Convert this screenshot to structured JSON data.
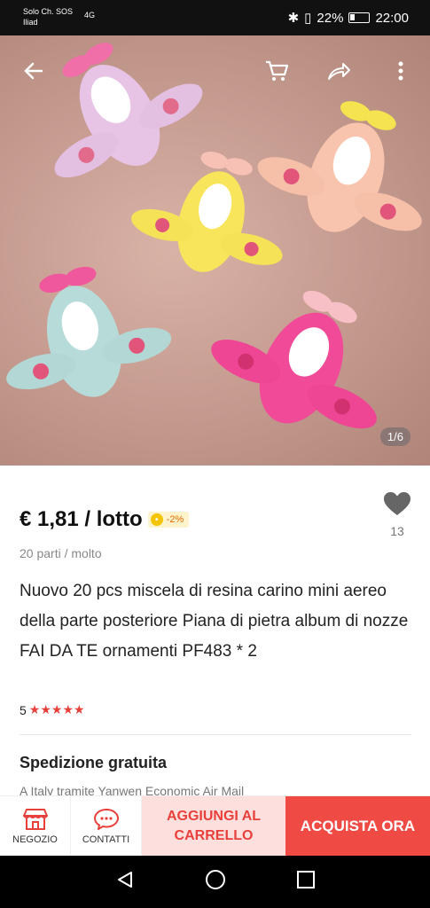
{
  "status_bar": {
    "carrier_line1": "Solo Ch. SOS",
    "carrier_line2": "Iliad",
    "signal_text": "4G",
    "battery_percent": "22%",
    "time": "22:00"
  },
  "hero": {
    "image_counter": "1/6"
  },
  "product": {
    "price": "€ 1,81 / lotto",
    "discount": "-2%",
    "favorites_count": "13",
    "unit_info": "20 parti / molto",
    "title": "Nuovo 20 pcs miscela di resina carino mini aereo della parte posteriore Piana di pietra album di nozze FAI DA TE ornamenti PF483 * 2",
    "rating_value": "5",
    "rating_stars": "★★★★★"
  },
  "shipping": {
    "title": "Spedizione gratuita",
    "subtitle": "A Italy tramite Yanwen Economic Air Mail"
  },
  "action_bar": {
    "store_label": "NEGOZIO",
    "contact_label": "CONTATTI",
    "add_to_cart_label": "AGGIUNGI AL CARRELLO",
    "buy_now_label": "ACQUISTA ORA"
  },
  "colors": {
    "accent": "#ef4a44",
    "cart_bg": "#fde0de",
    "star": "#e8403a"
  }
}
